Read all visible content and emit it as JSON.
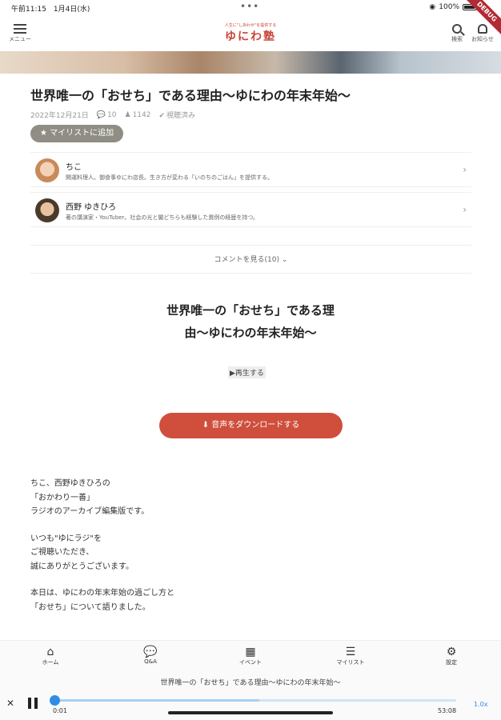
{
  "status_bar": {
    "time": "午前11:15　1月4日(水)",
    "dots": "•••",
    "battery": "100%",
    "debug_badge": "DEBUG"
  },
  "header": {
    "menu_label": "メニュー",
    "logo_tagline": "人生に\"しあわせ\"を提供する",
    "logo_name": "ゆにわ塾",
    "search_label": "検索",
    "notifications_label": "お知らせ"
  },
  "episode": {
    "title": "世界唯一の「おせち」である理由〜ゆにわの年末年始〜",
    "date": "2022年12月21日",
    "comment_count": "10",
    "listen_count": "1142",
    "watched_label": "視聴済み",
    "mylist_button": "マイリストに追加"
  },
  "authors": [
    {
      "name": "ちこ",
      "description": "開運料理人。御食事ゆにわ店長。生き方が変わる「いのちのごはん」を提供する。"
    },
    {
      "name": "西野 ゆきひろ",
      "description": "著の講演家・YouTuber。社会の光と闇どちらも経験した異例の経歴を持つ。"
    }
  ],
  "comments_link": "コメントを見る(10)",
  "article": {
    "title_line1": "世界唯一の「おせち」である理",
    "title_line2": "由〜ゆにわの年末年始〜",
    "play_label": "再生する",
    "download_button": "音声をダウンロードする",
    "paragraphs": [
      [
        "ちこ、西野ゆきひろの",
        "「おかわり一善」",
        "ラジオのアーカイブ編集版です。"
      ],
      [
        "いつも\"ゆにラジ\"を",
        "ご視聴いただき、",
        "誠にありがとうございます。"
      ],
      [
        "本日は、ゆにわの年末年始の過ごし方と",
        "「おせち」について語りました。"
      ]
    ]
  },
  "bottom_nav": {
    "home": "ホーム",
    "qa": "Q&A",
    "event": "イベント",
    "mylist": "マイリスト",
    "settings": "設定"
  },
  "player": {
    "title": "世界唯一の「おせち」である理由〜ゆにわの年末年始〜",
    "current_time": "0:01",
    "duration": "53:08",
    "speed": "1.0x",
    "progress": 0.0003,
    "buffered": 0.51
  },
  "colors": {
    "accent": "#cf4e3c",
    "player_blue": "#2f8de4",
    "mylist_button_bg": "#8f8d84"
  }
}
